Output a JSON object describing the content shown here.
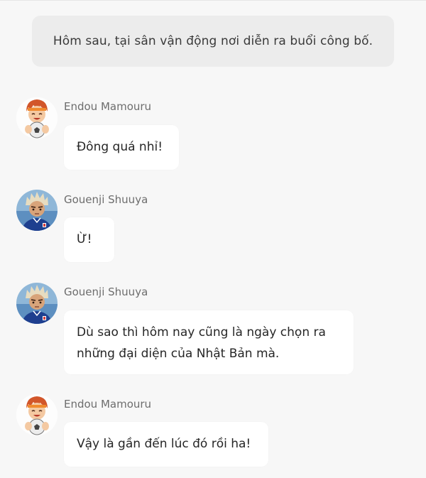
{
  "narration": "Hôm sau, tại sân vận động nơi diễn ra buổi công bố.",
  "messages": [
    {
      "speaker": "Endou Mamouru",
      "avatar": "endou-avatar",
      "text": "Đông quá nhỉ!"
    },
    {
      "speaker": "Gouenji Shuuya",
      "avatar": "gouenji-avatar",
      "text": "Ừ!"
    },
    {
      "speaker": "Gouenji Shuuya",
      "avatar": "gouenji-avatar",
      "text": "Dù sao thì hôm nay cũng là ngày chọn ra những đại diện của Nhật Bản mà."
    },
    {
      "speaker": "Endou Mamouru",
      "avatar": "endou-avatar",
      "text": "Vậy là gần đến lúc đó rồi ha!"
    }
  ],
  "colors": {
    "background": "#f7f7f7",
    "narration_bg": "#ececec",
    "bubble_bg": "#ffffff",
    "name_text": "#6d6d6d"
  }
}
